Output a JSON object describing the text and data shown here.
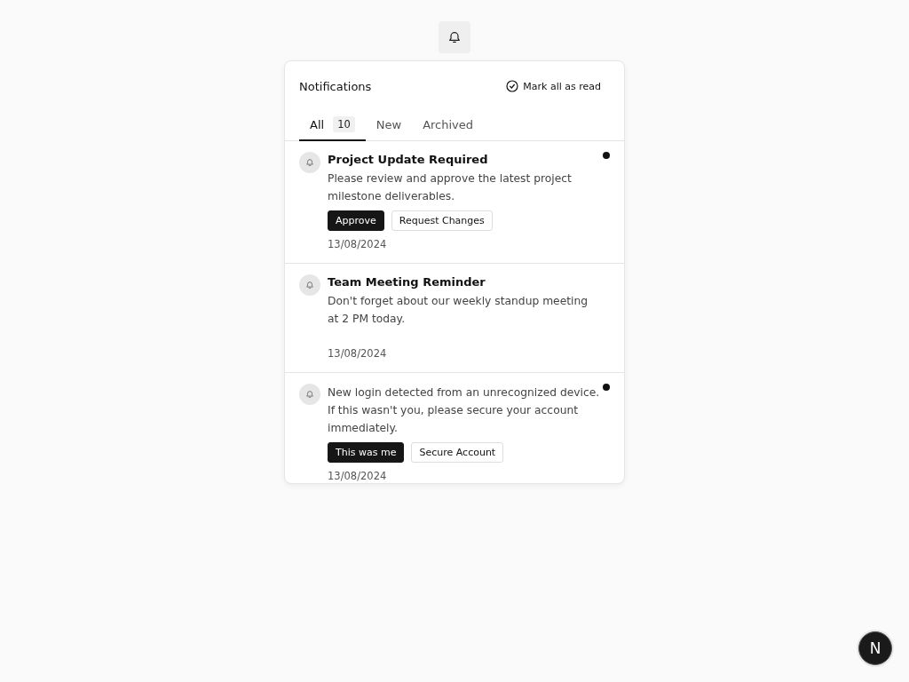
{
  "header": {
    "title": "Notifications",
    "mark_all": "Mark all as read"
  },
  "tabs": [
    {
      "label": "All",
      "count": "10",
      "selected": true
    },
    {
      "label": "New",
      "selected": false
    },
    {
      "label": "Archived",
      "selected": false
    }
  ],
  "notifications": [
    {
      "title": "Project Update Required",
      "message": "Please review and approve the latest project milestone deliverables.",
      "unread": true,
      "actions": [
        {
          "label": "Approve",
          "primary": true
        },
        {
          "label": "Request Changes",
          "primary": false
        }
      ],
      "date": "13/08/2024"
    },
    {
      "title": "Team Meeting Reminder",
      "message": "Don't forget about our weekly standup meeting at 2 PM today.",
      "unread": false,
      "date": "13/08/2024"
    },
    {
      "message": "New login detected from an unrecognized device. If this wasn't you, please secure your account immediately.",
      "unread": true,
      "actions": [
        {
          "label": "This was me",
          "primary": true
        },
        {
          "label": "Secure Account",
          "primary": false
        }
      ],
      "date": "13/08/2024"
    }
  ],
  "dev_badge": {
    "label": "N"
  }
}
